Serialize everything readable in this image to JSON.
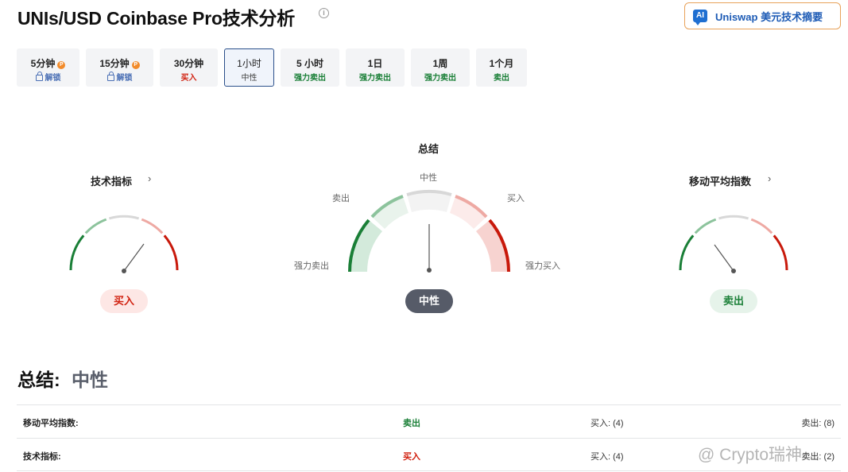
{
  "header": {
    "title": "UNIs/USD Coinbase Pro技术分析",
    "ai_badge": "AI",
    "ai_button": "Uniswap 美元技术摘要"
  },
  "timeframes": [
    {
      "label": "5分钟",
      "sub": "解锁",
      "locked": true
    },
    {
      "label": "15分钟",
      "sub": "解锁",
      "locked": true
    },
    {
      "label": "30分钟",
      "sub": "买入"
    },
    {
      "label": "1小时",
      "sub": "中性",
      "active": true
    },
    {
      "label": "5 小时",
      "sub": "强力卖出"
    },
    {
      "label": "1日",
      "sub": "强力卖出"
    },
    {
      "label": "1周",
      "sub": "强力卖出"
    },
    {
      "label": "1个月",
      "sub": "卖出"
    }
  ],
  "gauges": {
    "technical": {
      "title": "技术指标",
      "chevron": "›",
      "signal": "买入"
    },
    "summary": {
      "title": "总结",
      "signal": "中性",
      "labels": {
        "neutral": "中性",
        "sell": "卖出",
        "buy": "买入",
        "strong_sell": "强力卖出",
        "strong_buy": "强力买入"
      }
    },
    "moving_avg": {
      "title": "移动平均指数",
      "chevron": "›",
      "signal": "卖出"
    }
  },
  "summary": {
    "heading": "总结:",
    "value": "中性"
  },
  "table": [
    {
      "name": "移动平均指数:",
      "signal": "卖出",
      "buy": "买入: (4)",
      "sell": "卖出: (8)"
    },
    {
      "name": "技术指标:",
      "signal": "买入",
      "buy": "买入: (4)",
      "sell": "卖出: (2)"
    }
  ],
  "watermark": "@ Crypto瑞神",
  "colors": {
    "sell": "#1a7f37",
    "buy": "#d1200f",
    "neutral": "#5a5f6b",
    "strong_sell": "#1a7f37",
    "strong_buy": "#c8190b",
    "accent": "#1d5bb5"
  }
}
